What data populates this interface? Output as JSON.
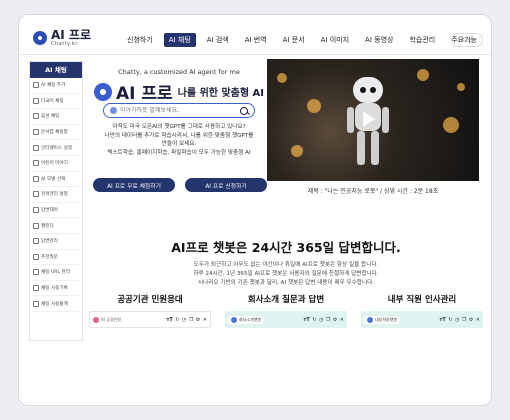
{
  "brand": {
    "name": "AI 프로",
    "sub": "Chatty.kr"
  },
  "nav": [
    "신청하기",
    "AI 채팅",
    "AI 검색",
    "AI 번역",
    "AI 문서",
    "AI 이미지",
    "AI 동영상",
    "학습관리",
    "주요기능"
  ],
  "nav_active_index": 1,
  "login_label": "로그인",
  "sidebar": {
    "title": "AI 채팅",
    "items": [
      "AI 채팅 추가",
      "다국어 채팅",
      "음성 채팅",
      "문서업 채팅창",
      "인터페이스 설정",
      "어린이 이야기",
      "AI 모델 선택",
      "검색엔진 설정",
      "답변제어",
      "캘린더",
      "답변관리",
      "추천질문",
      "채팅 URL 관리",
      "채팅 사용기록",
      "채팅 사용통계"
    ]
  },
  "hero": {
    "tagline": "Chatty, a customized AI agent for me",
    "title_ai": "AI 프로",
    "title_rest": "나를 위한 맞춤형 AI",
    "search_placeholder": "이야기하듯 말해보세요.",
    "desc": [
      "아직도 미국 오픈AI의 챗GPT를 그대로 사용하고 있나요?",
      "나만의 데이터를 추가로 학습시켜서, 나를 위한 맞춤형 챗GPT를",
      "만들어 보세요.",
      "텍스트학습, 홈페이지학습, 파일학습이 모두 가능한 맞춤형 AI"
    ],
    "btn_free": "AI 프로 무료 체험하기",
    "btn_apply": "AI 프로 신청하기"
  },
  "video": {
    "caption": "제목 : \"나는 인공지능 로봇\" / 상영 시간 : 2분 18초"
  },
  "section": {
    "title": "AI프로 챗봇은 24시간 365일 답변합니다.",
    "desc": [
      "도두가 퇴근하고 아무도 없는 야간이나 휴일에 AI프로 챗봇은 항상 일을 합니다.",
      "하루 24시간, 1년 365일 AI프로 챗봇은 사용자의 질문에 친절하게 답변합니다.",
      "시나리오 기반의 기존 챗봇과 달리, AI 챗봇은 답변 내용이 매우 우수합니다."
    ]
  },
  "cards": [
    {
      "title": "공공기관 민원응대",
      "badge": "AI 공공민원"
    },
    {
      "title": "회사소개 질문과 답변",
      "badge": "회사소개챗봇"
    },
    {
      "title": "내부 직원 인사관리",
      "badge": "내부직원챗봇"
    }
  ],
  "toolbar_icons": [
    "text-size-icon",
    "refresh-icon",
    "history-icon",
    "copy-icon",
    "settings-icon",
    "close-icon"
  ]
}
